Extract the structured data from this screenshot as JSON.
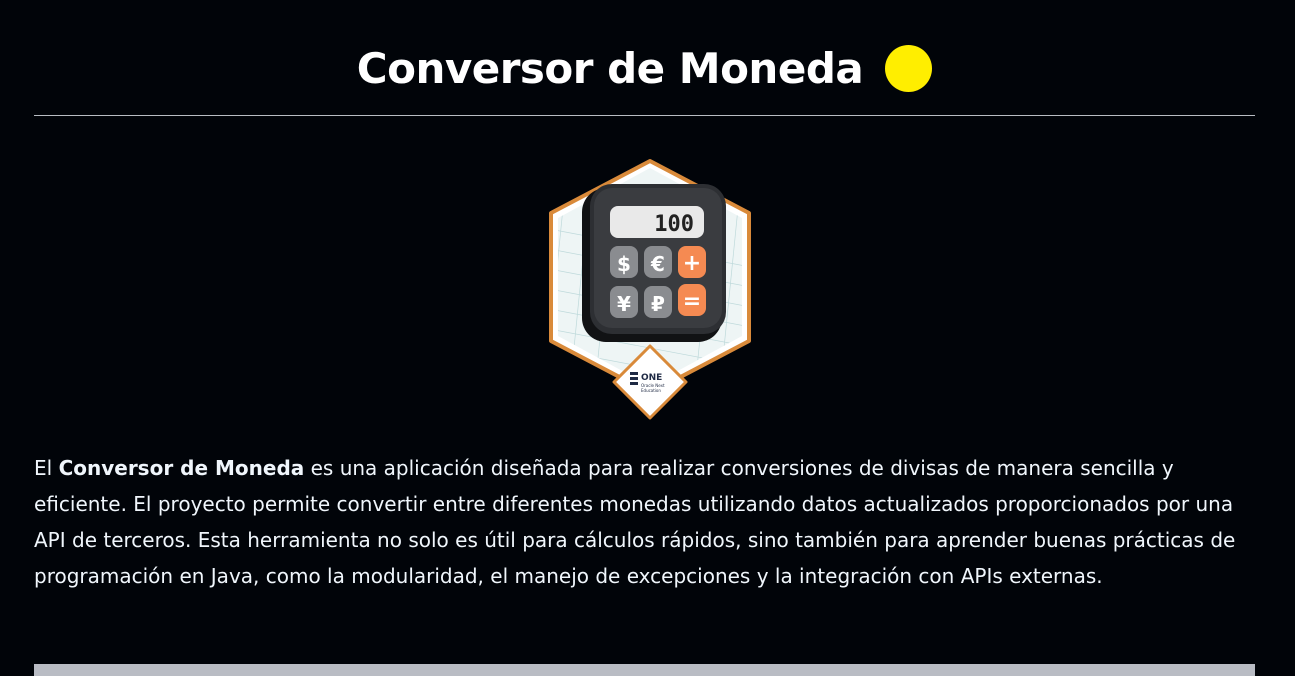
{
  "header": {
    "title": "Conversor de Moneda",
    "emoji": "yellow-circle"
  },
  "badge": {
    "display_value": "100",
    "keys": [
      "$",
      "€",
      "+",
      "¥",
      "₽",
      "="
    ],
    "brand": "ONE",
    "brand_sub_1": "Oracle Next",
    "brand_sub_2": "Education"
  },
  "description": {
    "prefix": "El ",
    "bold": "Conversor de Moneda",
    "body": " es una aplicación diseñada para realizar conversiones de divisas de manera sencilla y eficiente. El proyecto permite convertir entre diferentes monedas utilizando datos actualizados proporcionados por una API de terceros. Esta herramienta no solo es útil para cálculos rápidos, sino también para aprender buenas prácticas de programación en Java, como la modularidad, el manejo de excepciones y la integración con APIs externas."
  },
  "colors": {
    "background": "#010409",
    "text": "#f0f6fc",
    "accent_orange": "#d98a3a",
    "sun": "#ffee00"
  }
}
